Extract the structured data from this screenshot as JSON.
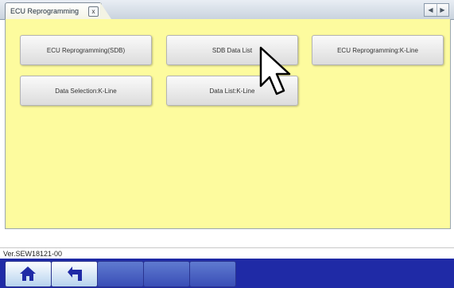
{
  "tab": {
    "label": "ECU Reprogramming",
    "close_glyph": "x"
  },
  "tabbar_controls": {
    "scroll_left_glyph": "◀",
    "scroll_right_glyph": "▶"
  },
  "function_buttons": [
    {
      "label": "ECU Reprogramming(SDB)"
    },
    {
      "label": "SDB Data List"
    },
    {
      "label": "ECU Reprogramming:K-Line"
    },
    {
      "label": "Data Selection:K-Line"
    },
    {
      "label": "Data List:K-Line"
    }
  ],
  "version": "Ver.SEW18121-00",
  "taskbar": {
    "buttons": [
      {
        "icon": "home-icon"
      },
      {
        "icon": "back-arrow-icon"
      },
      {
        "icon": ""
      },
      {
        "icon": ""
      },
      {
        "icon": ""
      }
    ]
  },
  "colors": {
    "panel_background": "#fdfb9e",
    "taskbar_background": "#1f2aa6"
  }
}
